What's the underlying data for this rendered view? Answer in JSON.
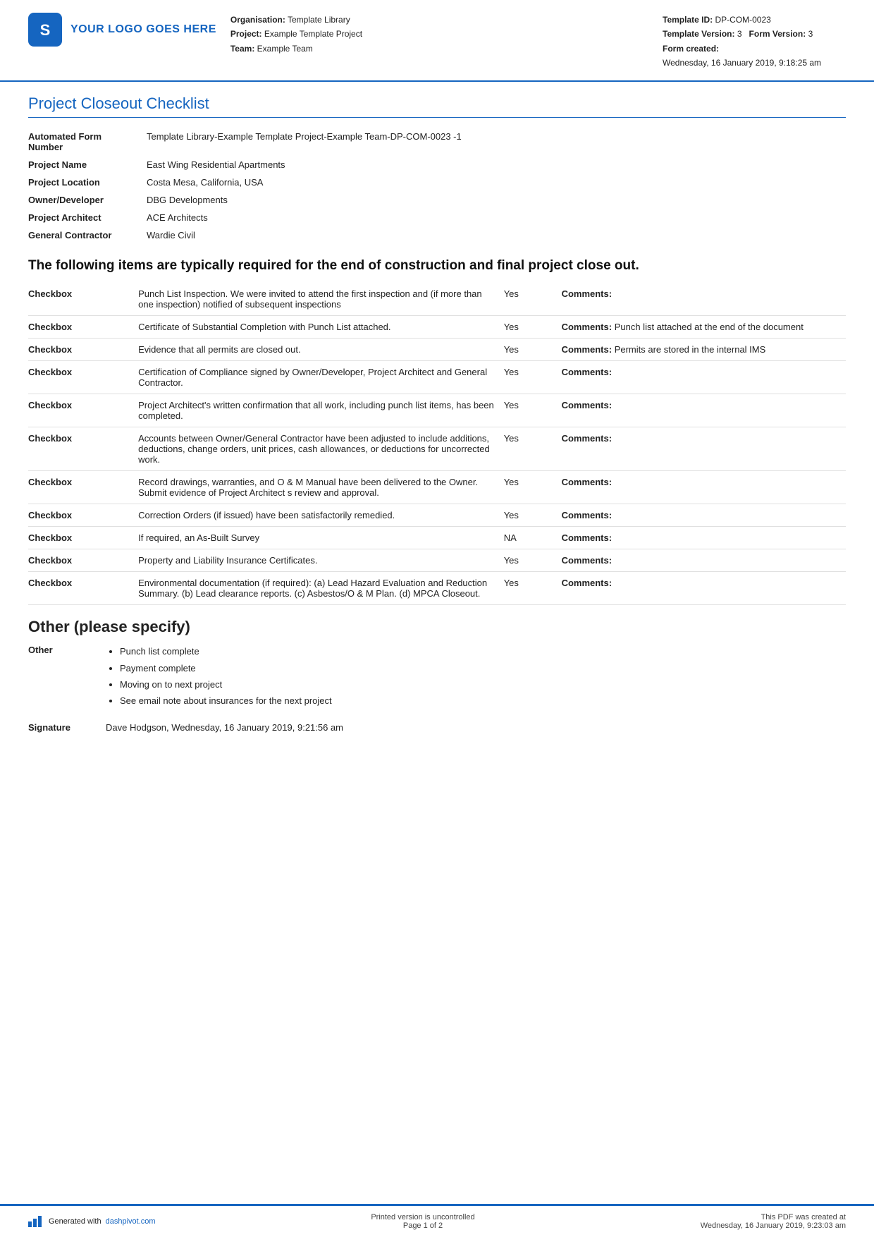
{
  "header": {
    "logo_text": "YOUR LOGO GOES HERE",
    "organisation_label": "Organisation:",
    "organisation_value": "Template Library",
    "project_label": "Project:",
    "project_value": "Example Template Project",
    "team_label": "Team:",
    "team_value": "Example Team",
    "template_id_label": "Template ID:",
    "template_id_value": "DP-COM-0023",
    "template_version_label": "Template Version:",
    "template_version_value": "3",
    "form_version_label": "Form Version:",
    "form_version_value": "3",
    "form_created_label": "Form created:",
    "form_created_value": "Wednesday, 16 January 2019, 9:18:25 am"
  },
  "doc_title": "Project Closeout Checklist",
  "info_rows": [
    {
      "label": "Automated Form Number",
      "value": "Template Library-Example Template Project-Example Team-DP-COM-0023   -1"
    },
    {
      "label": "Project Name",
      "value": "East Wing Residential Apartments"
    },
    {
      "label": "Project Location",
      "value": "Costa Mesa, California, USA"
    },
    {
      "label": "Owner/Developer",
      "value": "DBG Developments"
    },
    {
      "label": "Project Architect",
      "value": "ACE Architects"
    },
    {
      "label": "General Contractor",
      "value": "Wardie Civil"
    }
  ],
  "section_heading": "The following items are typically required for the end of construction and final project close out.",
  "checklist": [
    {
      "checkbox": "Checkbox",
      "description": "Punch List Inspection. We were invited to attend the first inspection and (if more than one inspection) notified of subsequent inspections",
      "status": "Yes",
      "comments_label": "Comments:",
      "comments_value": ""
    },
    {
      "checkbox": "Checkbox",
      "description": "Certificate of Substantial Completion with Punch List attached.",
      "status": "Yes",
      "comments_label": "Comments:",
      "comments_value": "Punch list attached at the end of the document"
    },
    {
      "checkbox": "Checkbox",
      "description": "Evidence that all permits are closed out.",
      "status": "Yes",
      "comments_label": "Comments:",
      "comments_value": "Permits are stored in the internal IMS"
    },
    {
      "checkbox": "Checkbox",
      "description": "Certification of Compliance signed by Owner/Developer, Project Architect and General Contractor.",
      "status": "Yes",
      "comments_label": "Comments:",
      "comments_value": ""
    },
    {
      "checkbox": "Checkbox",
      "description": "Project Architect's written confirmation that all work, including punch list items, has been completed.",
      "status": "Yes",
      "comments_label": "Comments:",
      "comments_value": ""
    },
    {
      "checkbox": "Checkbox",
      "description": "Accounts between Owner/General Contractor have been adjusted to include additions, deductions, change orders, unit prices, cash allowances, or deductions for uncorrected work.",
      "status": "Yes",
      "comments_label": "Comments:",
      "comments_value": ""
    },
    {
      "checkbox": "Checkbox",
      "description": "Record drawings, warranties, and O & M Manual have been delivered to the Owner. Submit evidence of Project Architect s review and approval.",
      "status": "Yes",
      "comments_label": "Comments:",
      "comments_value": ""
    },
    {
      "checkbox": "Checkbox",
      "description": "Correction Orders (if issued) have been satisfactorily remedied.",
      "status": "Yes",
      "comments_label": "Comments:",
      "comments_value": ""
    },
    {
      "checkbox": "Checkbox",
      "description": "If required, an As-Built Survey",
      "status": "NA",
      "comments_label": "Comments:",
      "comments_value": ""
    },
    {
      "checkbox": "Checkbox",
      "description": "Property and Liability Insurance Certificates.",
      "status": "Yes",
      "comments_label": "Comments:",
      "comments_value": ""
    },
    {
      "checkbox": "Checkbox",
      "description": "Environmental documentation (if required): (a) Lead Hazard Evaluation and Reduction Summary. (b) Lead clearance reports. (c) Asbestos/O & M Plan. (d) MPCA Closeout.",
      "status": "Yes",
      "comments_label": "Comments:",
      "comments_value": ""
    }
  ],
  "other_section": {
    "heading": "Other (please specify)",
    "label": "Other",
    "items": [
      "Punch list complete",
      "Payment complete",
      "Moving on to next project",
      "See email note about insurances for the next project"
    ]
  },
  "signature": {
    "label": "Signature",
    "value": "Dave Hodgson, Wednesday, 16 January 2019, 9:21:56 am"
  },
  "footer": {
    "generated_text": "Generated with ",
    "link_text": "dashpivot.com",
    "center_line1": "Printed version is uncontrolled",
    "center_line2": "Page 1 of 2",
    "right_line1": "This PDF was created at",
    "right_line2": "Wednesday, 16 January 2019, 9:23:03 am",
    "page_of": "of 2"
  }
}
